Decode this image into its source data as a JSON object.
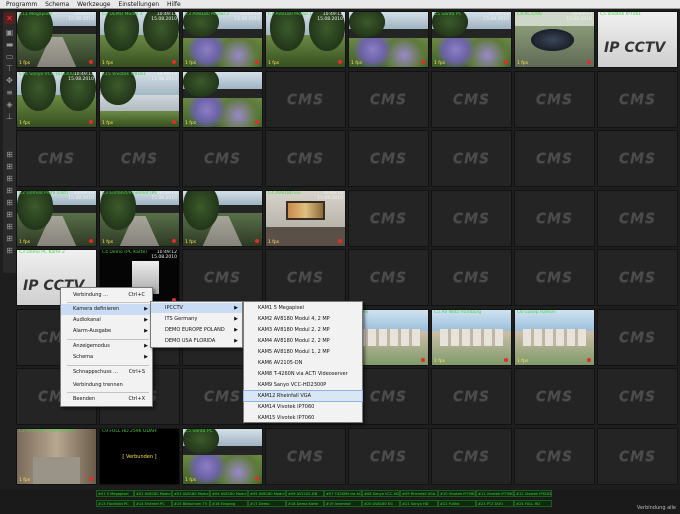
{
  "menu": [
    "Programm",
    "Schema",
    "Werkzeuge",
    "Einstellungen",
    "Hilfe"
  ],
  "toolbar_icons": [
    "close-icon",
    "lock-icon",
    "layout-icon",
    "layout-icon",
    "layout-icon",
    "move-icon",
    "layout-icon",
    "layout-icon",
    "layout-icon"
  ],
  "layout_icons": [
    "grid-1-icon",
    "grid-2-icon",
    "grid-3-icon",
    "grid-4-icon",
    "grid-5-icon",
    "grid-6-icon",
    "grid-7-icon",
    "grid-8-icon",
    "grid-9-icon"
  ],
  "empty_logo": "CMS",
  "cameras": [
    {
      "label": "C11 Megapixel",
      "time": "10:49:13\n15.08.2010",
      "scene": "road"
    },
    {
      "label": "C2 DEMO Modul 3",
      "time": "10:49:13\n15.08.2010",
      "scene": "garden"
    },
    {
      "label": "C3 AV8180 Modul 2",
      "time": "10:49:13\n15.08.2010",
      "scene": "flowers"
    },
    {
      "label": "C1 AV8180 Modul 1",
      "time": "10:49:13\n15.08.2010",
      "scene": "garden"
    },
    {
      "label": "",
      "time": "",
      "scene": "flowers"
    },
    {
      "label": "C5 Santa PC",
      "time": "10:49:13\n15.08.2010",
      "scene": "flowers"
    },
    {
      "label": "C4 ACTi/VS",
      "time": "10:49:13\n15.08.2010",
      "scene": "car"
    },
    {
      "label": "C5 Vivotek IP7161",
      "time": "",
      "scene": "sign"
    },
    {
      "label": "C14 Sanyo VCC-HD2300P",
      "time": "10:49:13\n15.08.2010",
      "scene": "garden"
    },
    {
      "label": "C15 Vivotek IP8161",
      "time": "10:49:13\n15.08.2010",
      "scene": "lake"
    },
    {
      "label": "",
      "time": "",
      "scene": "flowers"
    },
    {
      "label": "",
      "time": "",
      "scene": "road"
    },
    {
      "label": "C2 Umfeld Profil (Ost)",
      "time": "10:49:13\n15.08.2010",
      "scene": "road"
    },
    {
      "label": "C3 Einfahrt/Innenhof (PC 1)",
      "time": "10:49:13\n15.08.2010",
      "scene": "road"
    },
    {
      "label": "C4 AV8180 EG",
      "time": "10:49:14\n15.08.2010",
      "scene": "office"
    },
    {
      "label": "C3 Demo PC Karte 2",
      "time": "",
      "scene": "sign"
    },
    {
      "label": "C4 Demo (PC Karte)",
      "time": "10:49:12\n15.08.2010",
      "scene": "black"
    },
    {
      "label": "ACTi/VS",
      "time": "",
      "scene": "city"
    },
    {
      "label": "C5 AV Netz Hamburg",
      "time": "",
      "scene": "city"
    },
    {
      "label": "C6 Gosep Ramon",
      "time": "",
      "scene": "city"
    },
    {
      "label": "C1 PTZ DUO 2560 ODAHSC PTZ",
      "time": "",
      "scene": "street"
    },
    {
      "label": "C9 FULL HD 2596 ODAHSC H",
      "time": "",
      "scene": "verbunden"
    },
    {
      "label": "C5 Santa PC",
      "time": "",
      "scene": "flowers"
    }
  ],
  "verbunden_text": "[ Verbunden ]",
  "fps": "1 fps",
  "context_menu": {
    "items": [
      {
        "label": "Verbindung ...",
        "shortcut": "Ctrl+C"
      },
      {
        "label": "Kamera definieren",
        "submenu": true
      },
      {
        "label": "Audiokanal",
        "submenu": true
      },
      {
        "label": "Alarm-Ausgabe",
        "submenu": true
      },
      {
        "label": "Anzeigemodus",
        "submenu": true
      },
      {
        "label": "Schema",
        "submenu": true
      },
      {
        "label": "Schnappschuss ...",
        "shortcut": "Ctrl+S"
      },
      {
        "label": "Verbindung trennen"
      },
      {
        "label": "Beenden",
        "shortcut": "Ctrl+X"
      }
    ]
  },
  "submenu1": [
    "IPCCTV",
    "ITS Germany",
    "DEMO EUROPE POLAND",
    "DEMO USA FLORIDA"
  ],
  "submenu2": [
    "KAM1 5 Megapixel",
    "KAM2 AV8180 Modul 4, 2 MP",
    "KAM3 AV8180 Modul 2, 2 MP",
    "KAM4 AV8180 Modul 2, 2 MP",
    "KAM5 AV8180 Modul 1, 2 MP",
    "KAM6 AV2105-DN",
    "KAM8 T-4260N via ACTi Videoserver",
    "KAM9 Sanyo VCC-HD2300P",
    "KAM12 Rheinfall VGA",
    "KAM14 Vivotek IP7060",
    "KAM15 Vivotek IP7060"
  ],
  "status_tags": [
    "#01 5 Megapixel",
    "#02 AV8180 Modul 4",
    "#03 AV8180 Modul 2",
    "#04 AV8180 Modul 3",
    "#05 AV8180 Modul 1",
    "#06 AV2105-DN",
    "#07 T4260N via ACTi",
    "#08 Sanyo VCC-HD",
    "#09 Rheinfall VGA",
    "#10 Vivotek IP7060",
    "#11 Vivotek IP7060",
    "#12 Vivotek IP8161",
    "#13 Flachbild PC",
    "#14 Einfahrt PC",
    "#15 Bildschirm TV",
    "#16 Eingang",
    "#17 Demo",
    "#18 Demo Karte",
    "#19 Innenhof",
    "#20 AV8180 EG",
    "#21 Sanyo HD",
    "#22 Fullhd",
    "#23 PTZ DUO",
    "#24 FULL HD"
  ],
  "status_right": "Verbindung alle"
}
